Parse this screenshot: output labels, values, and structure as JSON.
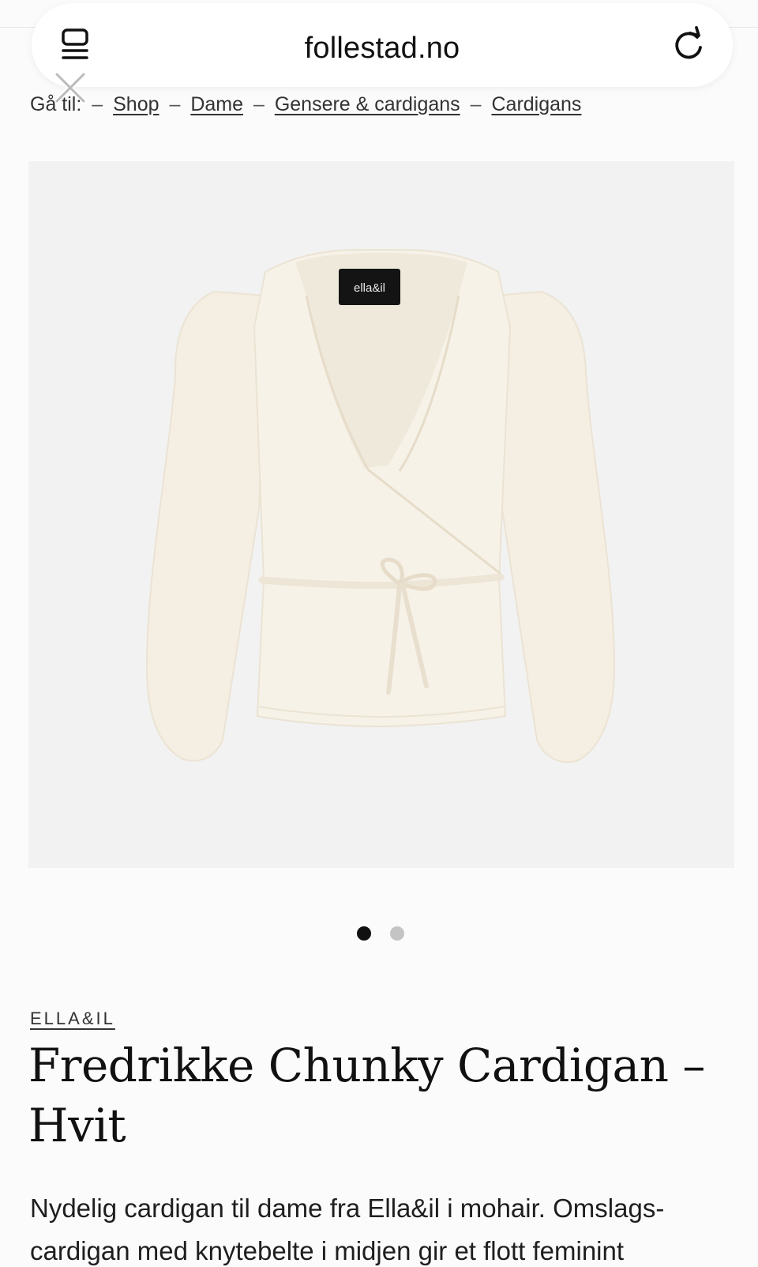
{
  "browser": {
    "url": "follestad.no",
    "tabs_icon": "tabs-icon",
    "reload_icon": "reload-icon",
    "close_icon": "close-icon"
  },
  "breadcrumb": {
    "prefix": "Gå til:",
    "separator": "–",
    "items": [
      "Shop",
      "Dame",
      "Gensere & cardigans",
      "Cardigans"
    ]
  },
  "product": {
    "image_label": "ella&il",
    "carousel": {
      "count": 2,
      "active_index": 0
    },
    "brand": "ELLA&IL",
    "title": "Fredrikke Chunky Cardigan – Hvit",
    "description": "Nydelig cardigan til dame fra Ella&il i mohair. Omslags-cardigan med knytebelte i midjen gir et flott feminint"
  },
  "colors": {
    "background": "#fbfbfb",
    "image_background": "#f2f2f2",
    "cardigan": "#f6f1e6",
    "text": "#1b1b1b",
    "dot_active": "#111111",
    "dot_inactive": "#c4c4c4"
  }
}
